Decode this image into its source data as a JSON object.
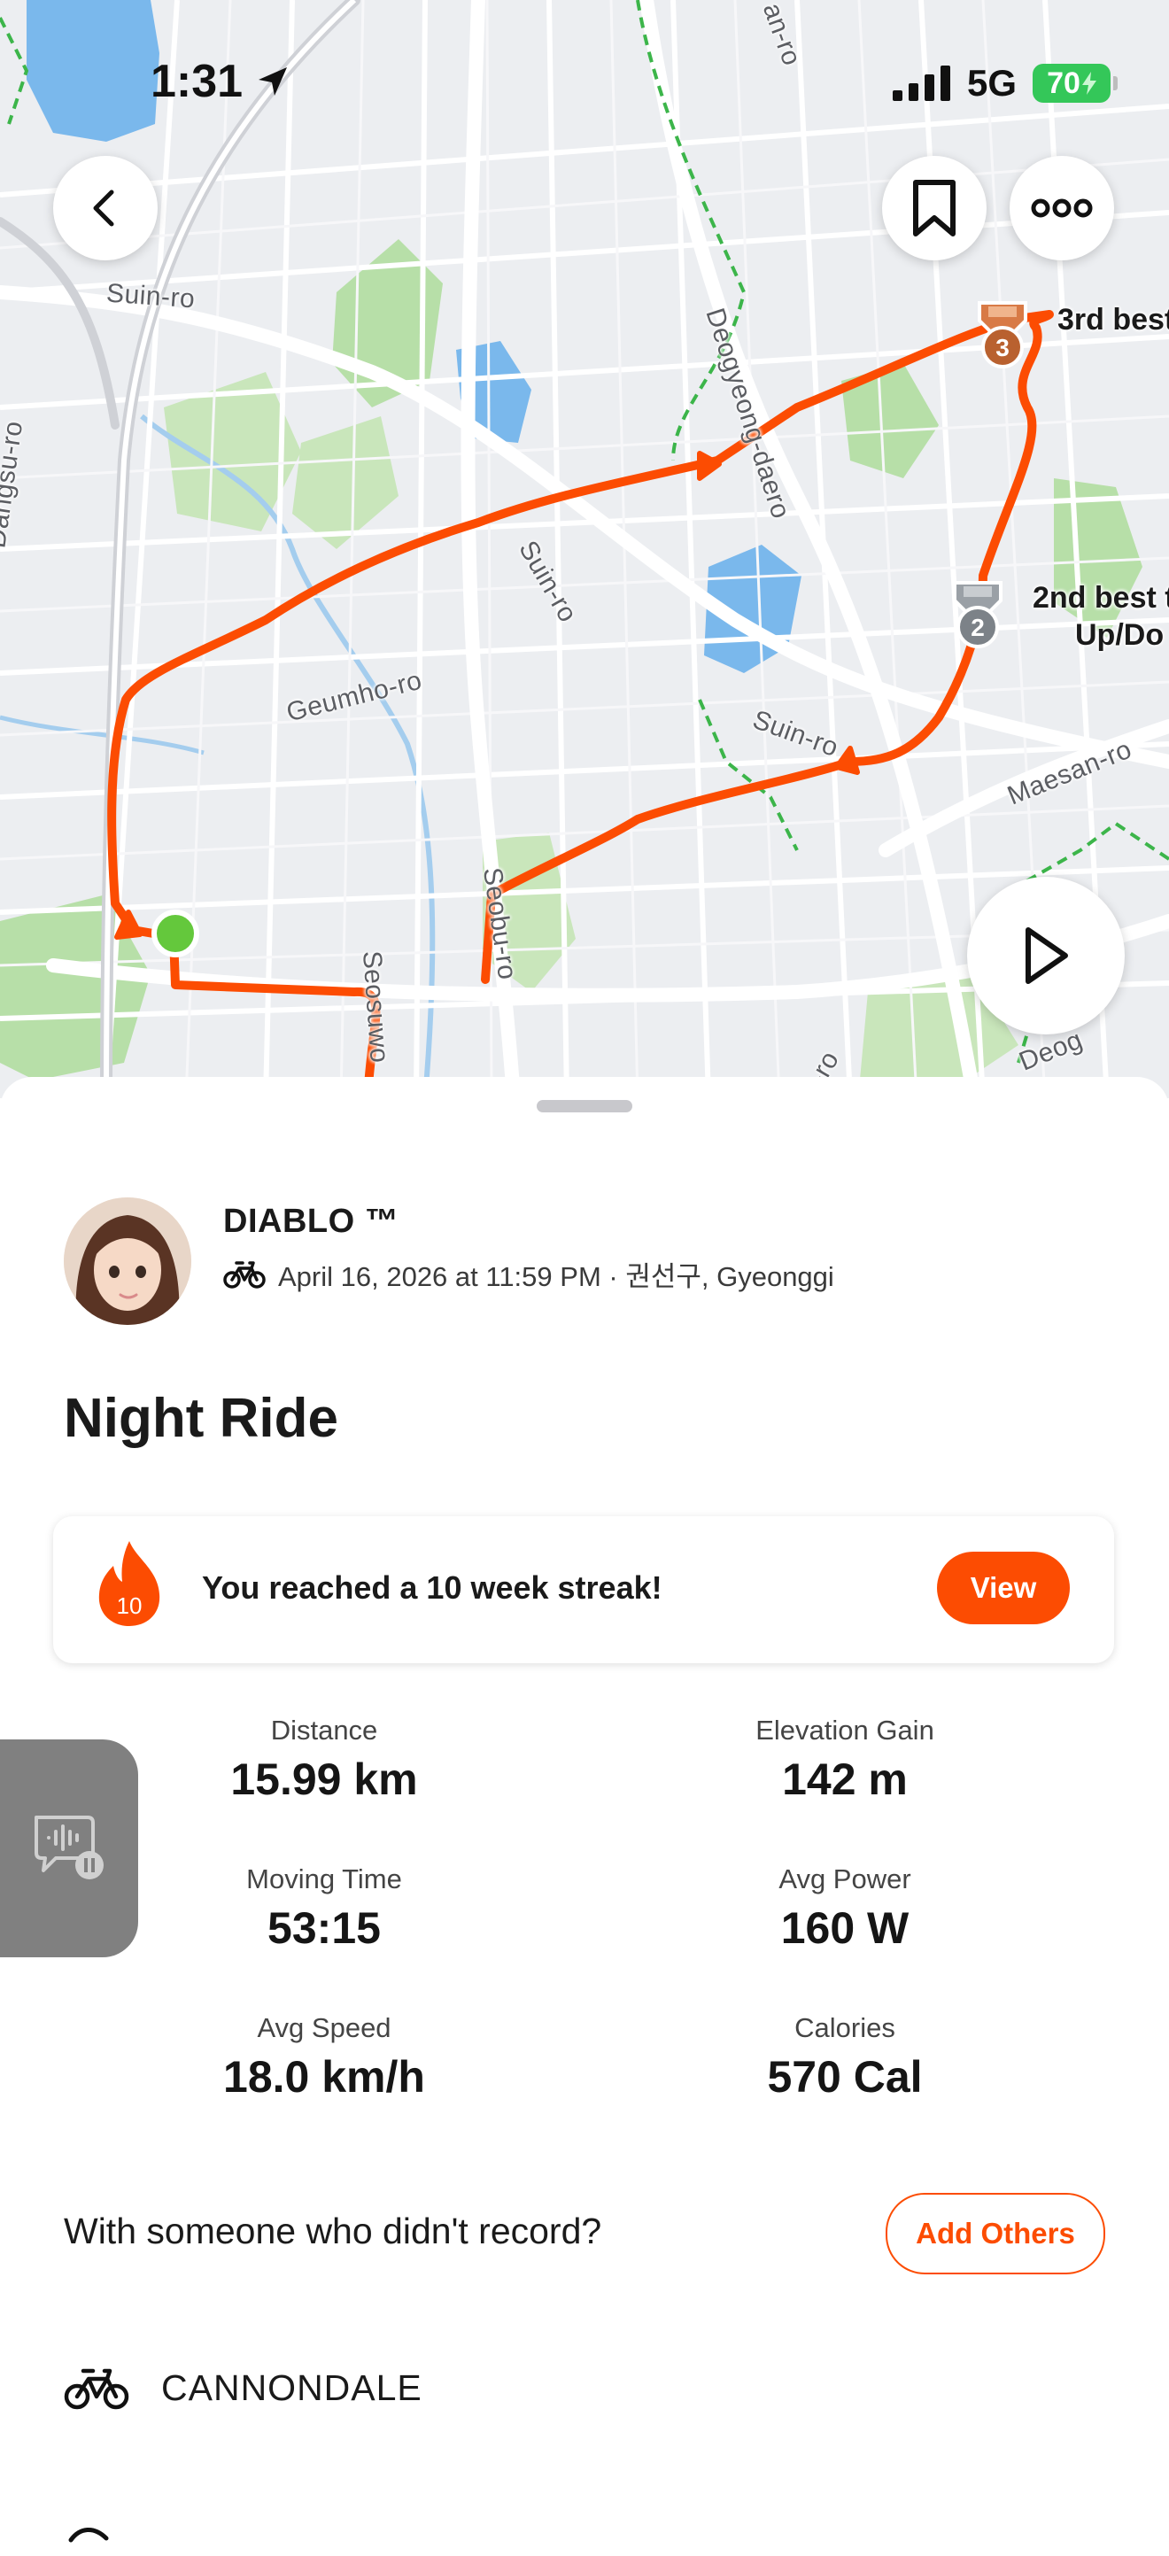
{
  "status_bar": {
    "time": "1:31",
    "network": "5G",
    "battery": "70"
  },
  "map": {
    "labels": [
      "Suin-ro",
      "Dangsu-ro",
      "Deogyeong-daero",
      "Suin-ro",
      "Geumho-ro",
      "Suin-ro",
      "Maesan-ro",
      "Seobu-ro",
      "Seosuwo",
      "an-ro",
      "Deog",
      "k-ro"
    ],
    "segments": [
      {
        "medal": "3",
        "label_line1": "3rd best",
        "label_line2": ""
      },
      {
        "medal": "2",
        "label_line1": "2nd best t",
        "label_line2": "Up/Do"
      }
    ],
    "route_color": "#fc4c02"
  },
  "athlete": {
    "name": "DIABLO ™",
    "meta": "April 16, 2026 at 11:59 PM · 권선구, Gyeonggi"
  },
  "activity": {
    "title": "Night Ride"
  },
  "streak": {
    "count": "10",
    "message": "You reached a 10 week streak!",
    "button": "View"
  },
  "stats": [
    {
      "label": "Distance",
      "value": "15.99 km"
    },
    {
      "label": "Elevation Gain",
      "value": "142 m"
    },
    {
      "label": "Moving Time",
      "value": "53:15"
    },
    {
      "label": "Avg Power",
      "value": "160 W"
    },
    {
      "label": "Avg Speed",
      "value": "18.0 km/h"
    },
    {
      "label": "Calories",
      "value": "570 Cal"
    }
  ],
  "add_others": {
    "prompt": "With someone who didn't record?",
    "button": "Add Others"
  },
  "gear": {
    "name": "CANNONDALE"
  },
  "colors": {
    "accent": "#fc4c02",
    "battery": "#34c759",
    "map_bg": "#eceef1"
  }
}
